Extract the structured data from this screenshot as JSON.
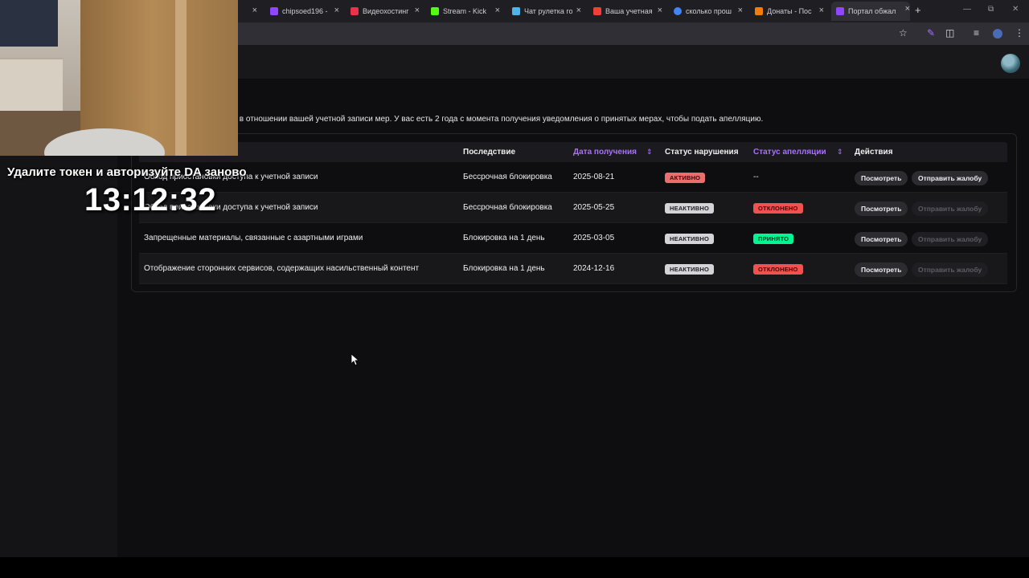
{
  "browser": {
    "tabs": [
      {
        "label": "",
        "fav_color": "#9147ff"
      },
      {
        "label": "chipsoed196 -",
        "fav_color": "#9147ff"
      },
      {
        "label": "Видеохостинг",
        "fav_color": "#e8334a"
      },
      {
        "label": "Stream - Kick",
        "fav_color": "#53fc18"
      },
      {
        "label": "Чат рулетка го",
        "fav_color": "#4db6e8"
      },
      {
        "label": "Ваша учетная",
        "fav_color": "#ea4335"
      },
      {
        "label": "сколько прош",
        "fav_color": "#4285f4"
      },
      {
        "label": "Донаты - Пос",
        "fav_color": "#f57d07"
      },
      {
        "label": "Портал обжал",
        "fav_color": "#9147ff"
      }
    ],
    "close_glyph": "×",
    "new_tab_glyph": "+"
  },
  "intro_text": "х в отношении вашей учетной записи мер. У вас есть 2 года с момента получения уведомления о принятых мерах, чтобы подать апелляцию.",
  "table": {
    "headers": {
      "consequence": "Последствие",
      "received": "Дата получения",
      "violation_status": "Статус нарушения",
      "appeal_status": "Статус апелляции",
      "actions": "Действия"
    },
    "rows": [
      {
        "reason": "Обход приостановки доступа к учетной записи",
        "consequence": "Бессрочная блокировка",
        "date": "2025-08-21",
        "violation": "АКТИВНО",
        "appeal": "--",
        "view": "Посмотреть",
        "complain": "Отправить жалобу"
      },
      {
        "reason": "Обход приостановки доступа к учетной записи",
        "consequence": "Бессрочная блокировка",
        "date": "2025-05-25",
        "violation": "НЕАКТИВНО",
        "appeal": "ОТКЛОНЕНО",
        "view": "Посмотреть",
        "complain": "Отправить жалобу"
      },
      {
        "reason": "Запрещенные материалы, связанные с азартными играми",
        "consequence": "Блокировка на 1 день",
        "date": "2025-03-05",
        "violation": "НЕАКТИВНО",
        "appeal": "ПРИНЯТО",
        "view": "Посмотреть",
        "complain": "Отправить жалобу"
      },
      {
        "reason": "Отображение сторонних сервисов, содержащих насильственный контент",
        "consequence": "Блокировка на 1 день",
        "date": "2024-12-16",
        "violation": "НЕАКТИВНО",
        "appeal": "ОТКЛОНЕНО",
        "view": "Посмотреть",
        "complain": "Отправить жалобу"
      }
    ]
  },
  "overlay": {
    "message": "Удалите токен и авторизуйте DA заново",
    "clock": "13:12:32"
  },
  "colors": {
    "accent": "#a970ff",
    "active_badge": "#eb6d6d",
    "inactive_badge": "#d3d3d8",
    "rejected_badge": "#f05252",
    "accepted_badge": "#00f593"
  }
}
